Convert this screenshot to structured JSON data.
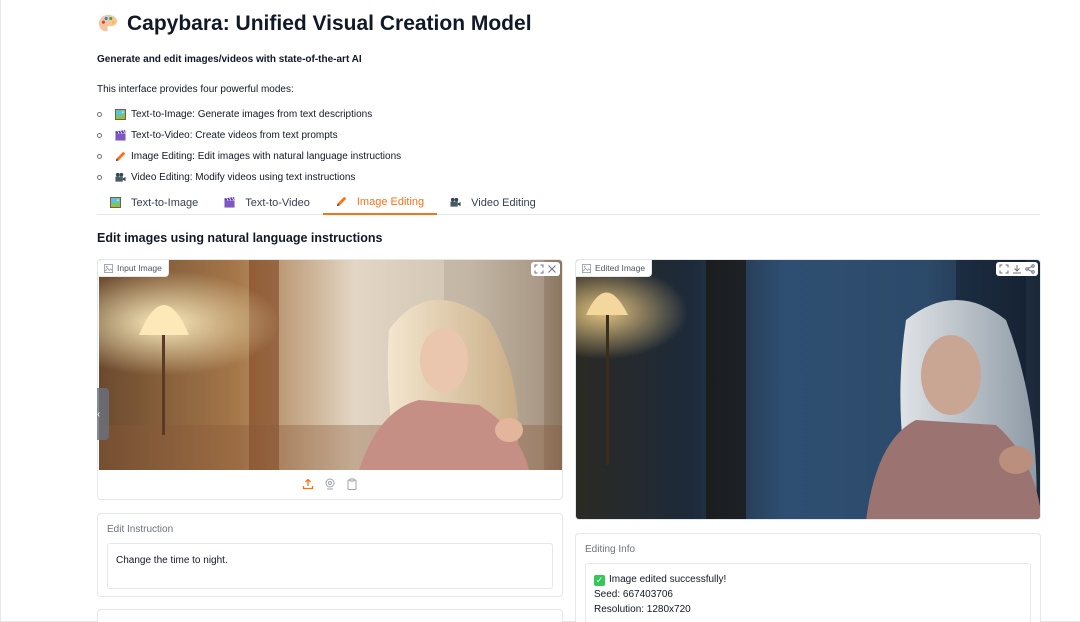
{
  "header": {
    "title": "Capybara: Unified Visual Creation Model",
    "subtitle": "Generate and edit images/videos with state-of-the-art AI",
    "intro": "This interface provides four powerful modes:",
    "modes": [
      {
        "icon": "framed-picture-icon",
        "text": "Text-to-Image: Generate images from text descriptions"
      },
      {
        "icon": "clapper-board-icon",
        "text": "Text-to-Video: Create videos from text prompts"
      },
      {
        "icon": "pencil-icon",
        "text": "Image Editing: Edit images with natural language instructions"
      },
      {
        "icon": "video-camera-icon",
        "text": "Video Editing: Modify videos using text instructions"
      }
    ]
  },
  "tabs": [
    {
      "icon": "framed-picture-icon",
      "label": "Text-to-Image",
      "active": false
    },
    {
      "icon": "clapper-board-icon",
      "label": "Text-to-Video",
      "active": false
    },
    {
      "icon": "pencil-icon",
      "label": "Image Editing",
      "active": true
    },
    {
      "icon": "video-camera-icon",
      "label": "Video Editing",
      "active": false
    }
  ],
  "main": {
    "section_title": "Edit images using natural language instructions",
    "input_image": {
      "label": "Input Image"
    },
    "edited_image": {
      "label": "Edited Image"
    },
    "instruction": {
      "label": "Edit Instruction",
      "value": "Change the time to night."
    },
    "info": {
      "label": "Editing Info",
      "status": "Image edited successfully!",
      "seed": "Seed: 667403706",
      "resolution": "Resolution: 1280x720"
    }
  },
  "colors": {
    "accent": "#f97316",
    "border": "#e5e7eb",
    "success": "#34c759"
  }
}
